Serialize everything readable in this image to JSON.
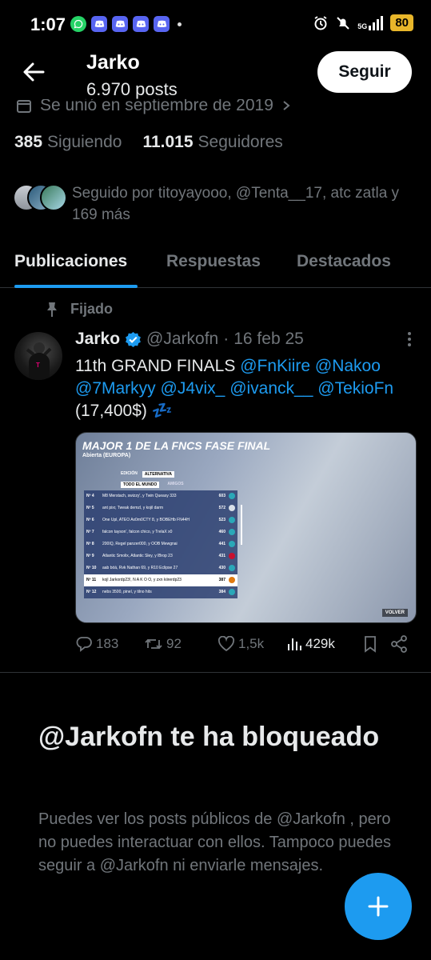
{
  "status_bar": {
    "time": "1:07",
    "network": "5G",
    "battery": "80"
  },
  "header": {
    "name": "Jarko",
    "posts": "6.970 posts",
    "follow_button": "Seguir"
  },
  "profile": {
    "joined": "Se unió en septiembre de 2019",
    "following_count": "385",
    "following_label": "Siguiendo",
    "followers_count": "11.015",
    "followers_label": "Seguidores",
    "followed_by": "Seguido por titoyayooo, @Tenta__17, atc zatla y 169 más"
  },
  "tabs": [
    {
      "label": "Publicaciones",
      "active": true
    },
    {
      "label": "Respuestas",
      "active": false
    },
    {
      "label": "Destacados",
      "active": false
    }
  ],
  "pinned_label": "Fijado",
  "tweet": {
    "name": "Jarko",
    "handle": "@Jarkofn",
    "dot": "·",
    "date": "16 feb 25",
    "text_prefix": "11th GRAND FINALS ",
    "mentions": [
      "@FnKiire",
      "@Nakoo",
      "@7Markyy",
      "@J4vix_",
      "@ivanck__",
      "@TekioFn"
    ],
    "text_suffix": "(17,400$) 💤",
    "media": {
      "title": "MAJOR 1 DE LA FNCS FASE FINAL",
      "subtitle": "Abierta (EUROPA)",
      "tab_left": "EDICIÓN",
      "tab_right": "ALTERNATIVA",
      "col_selected": "TODO EL MUNDO",
      "col_other": "AMIGOS",
      "rows": [
        {
          "rank": "Nº 4",
          "team": "M8 Merstach, swizzy', y Twin Queasy 333",
          "pts": "603"
        },
        {
          "rank": "Nº 5",
          "team": "ant pixr, Tweak demzl, y kojil darm",
          "pts": "572"
        },
        {
          "rank": "Nº 6",
          "team": "One Upl, ATEO Ax0m0CTY 8, y BOBEHb FN44H",
          "pts": "523"
        },
        {
          "rank": "Nº 7",
          "team": "falcon tayson', falcon chico, y TrelaX x0",
          "pts": "460"
        },
        {
          "rank": "Nº 8",
          "team": "200IQ, Regel panzer000, y OOB Mewgnai",
          "pts": "441"
        },
        {
          "rank": "Nº 9",
          "team": "Atlantic Smolix, Atlantic Sley, y lBrop 23",
          "pts": "431"
        },
        {
          "rank": "Nº 10",
          "team": "aab bóá, Rvk Nathan 69, y R10 Eclipse 27",
          "pts": "430"
        },
        {
          "rank": "Nº 11",
          "team": "kojl Jarkordp23!, N A K O O, y zxn kiirerdp23",
          "pts": "387"
        },
        {
          "rank": "Nº 12",
          "team": "nebs 3500, pinel, y tilno hits",
          "pts": "384"
        }
      ],
      "volver": "VOLVER"
    },
    "replies": "183",
    "reposts": "92",
    "likes": "1,5k",
    "views": "429k"
  },
  "blocked": {
    "title": "@Jarkofn te ha bloqueado",
    "body": "Puedes ver los posts públicos de @Jarkofn , pero no puedes interactuar con ellos. Tampoco puedes seguir a @Jarkofn ni enviarle mensajes."
  },
  "colors": {
    "accent": "#1d9bf0",
    "background": "#000000",
    "muted": "#71767b",
    "text": "#e7e9ea"
  }
}
